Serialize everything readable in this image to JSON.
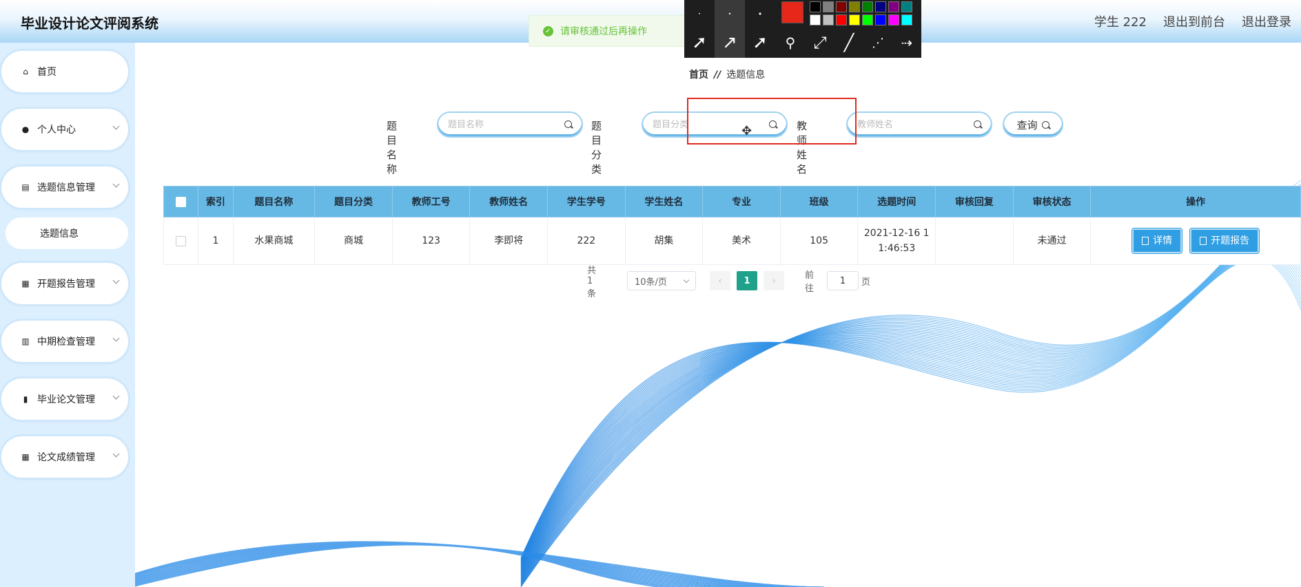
{
  "header": {
    "title": "毕业设计论文评阅系统",
    "user": "学生 222",
    "front_link": "退出到前台",
    "logout_link": "退出登录"
  },
  "toast": {
    "message": "请审核通过后再操作",
    "icon": "check-circle-icon"
  },
  "tool_panel": {
    "colors": [
      "#000000",
      "#808080",
      "#800000",
      "#808000",
      "#008000",
      "#000080",
      "#800080",
      "#008080",
      "#ffffff",
      "#c0c0c0",
      "#ff0000",
      "#ffff00",
      "#00ff00",
      "#0000ff",
      "#ff00ff",
      "#00ffff"
    ],
    "selected_color": "#e8271b"
  },
  "sidebar": {
    "items": [
      {
        "label": "首页",
        "icon": "home-icon"
      },
      {
        "label": "个人中心",
        "icon": "user-icon"
      },
      {
        "label": "选题信息管理",
        "icon": "clipboard-icon"
      },
      {
        "label": "开题报告管理",
        "icon": "grid-icon"
      },
      {
        "label": "中期检查管理",
        "icon": "book-icon"
      },
      {
        "label": "毕业论文管理",
        "icon": "bar-chart-icon"
      },
      {
        "label": "论文成绩管理",
        "icon": "grid-icon"
      }
    ],
    "sub_item": "选题信息"
  },
  "breadcrumb": {
    "home": "首页",
    "separator": "//",
    "current": "选题信息"
  },
  "search": {
    "fields": [
      {
        "label": "题目名称",
        "placeholder": "题目名称"
      },
      {
        "label": "题目分类",
        "placeholder": "题目分类"
      },
      {
        "label": "教师姓名",
        "placeholder": "教师姓名"
      }
    ],
    "query_label": "查询"
  },
  "table": {
    "columns": [
      "索引",
      "题目名称",
      "题目分类",
      "教师工号",
      "教师姓名",
      "学生学号",
      "学生姓名",
      "专业",
      "班级",
      "选题时间",
      "审核回复",
      "审核状态",
      "操作"
    ],
    "rows": [
      {
        "index": "1",
        "title": "水果商城",
        "category": "商城",
        "teacher_id": "123",
        "teacher_name": "李即将",
        "student_id": "222",
        "student_name": "胡集",
        "major": "美术",
        "class": "105",
        "time_line1": "2021-12-16 1",
        "time_line2": "1:46:53",
        "reply": "",
        "status": "未通过",
        "btn_detail": "详情",
        "btn_report": "开题报告"
      }
    ]
  },
  "pagination": {
    "total": "共 1 条",
    "page_size": "10条/页",
    "current_page": "1",
    "goto_prefix": "前往",
    "goto_value": "1",
    "goto_suffix": "页"
  }
}
